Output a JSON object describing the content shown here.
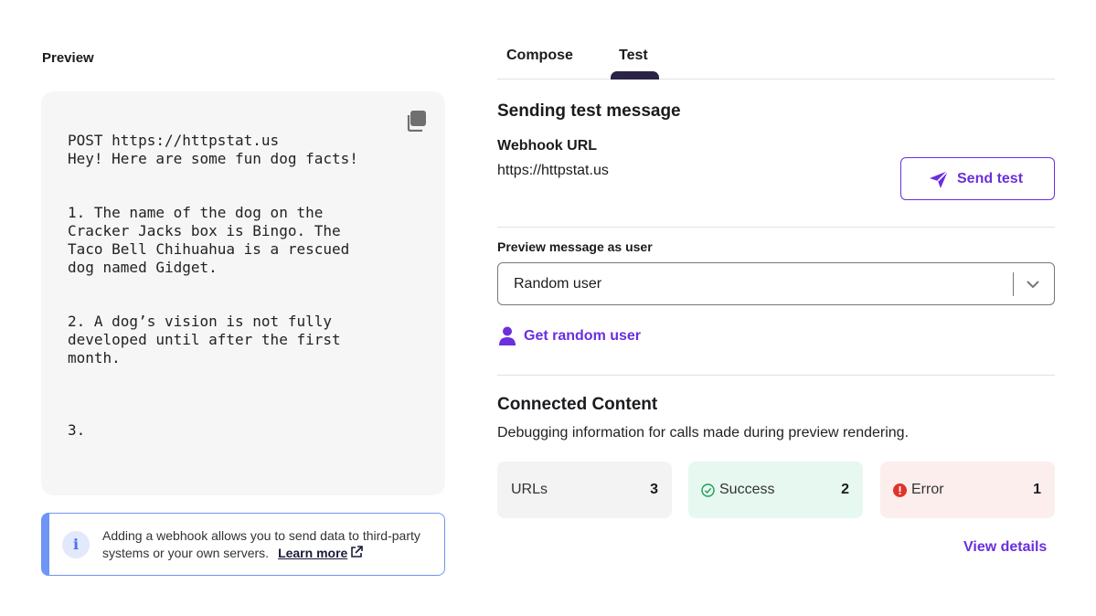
{
  "preview": {
    "heading": "Preview",
    "code": "POST https://httpstat.us\nHey! Here are some fun dog facts!\n\n\n1. The name of the dog on the Cracker Jacks box is Bingo. The Taco Bell Chihuahua is a rescued dog named Gidget.\n\n\n2. A dog’s vision is not fully developed until after the first month.\n\n\n\n3."
  },
  "info": {
    "text": "Adding a webhook allows you to send data to third-party systems or your own servers.",
    "link_label": "Learn more"
  },
  "tabs": [
    {
      "label": "Compose",
      "active": false
    },
    {
      "label": "Test",
      "active": true
    }
  ],
  "test": {
    "title": "Sending test message",
    "webhook_label": "Webhook URL",
    "webhook_url": "https://httpstat.us",
    "send_label": "Send test",
    "preview_user_label": "Preview message as user",
    "preview_user_value": "Random user",
    "random_user_link": "Get random user"
  },
  "connected_content": {
    "title": "Connected Content",
    "description": "Debugging information for calls made during preview rendering.",
    "stats": [
      {
        "label": "URLs",
        "count": "3"
      },
      {
        "label": "Success",
        "count": "2"
      },
      {
        "label": "Error",
        "count": "1"
      }
    ],
    "view_details": "View details"
  },
  "colors": {
    "accent": "#6a2fde",
    "tab_indicator": "#2b2345",
    "info_border": "#6f95f5",
    "success_bg": "#e6f8ef",
    "success_icon": "#1f9d55",
    "error_bg": "#fdeeee",
    "error_icon": "#e0342b"
  },
  "icons": [
    "copy-icon",
    "info-icon",
    "external-link-icon",
    "send-icon",
    "chevron-down-icon",
    "user-icon",
    "check-circle-icon",
    "error-icon"
  ]
}
